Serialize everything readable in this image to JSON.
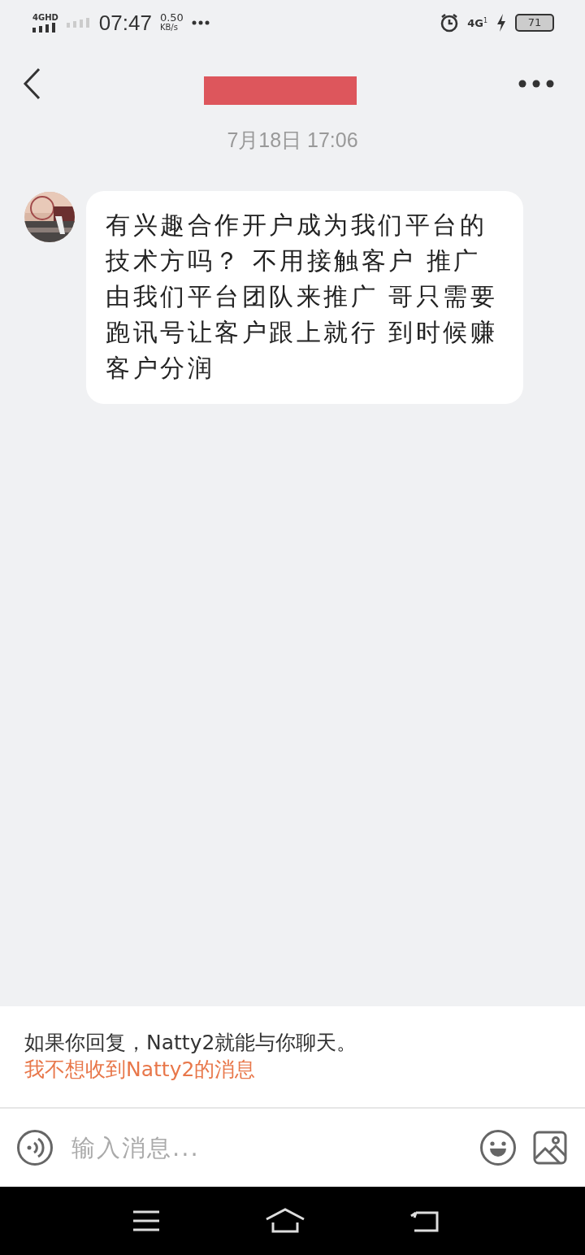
{
  "status_bar": {
    "network": "4GHD",
    "time": "07:47",
    "speed": "0.50",
    "speed_unit": "KB/s",
    "network_right": "4G",
    "sim": "1",
    "battery": "71"
  },
  "header": {
    "title_redacted": true
  },
  "date": "7月18日 17:06",
  "messages": [
    {
      "kind": "incoming",
      "text": "有兴趣合作开户成为我们平台的技术方吗？ 不用接触客户 推广由我们平台团队来推广 哥只需要跑讯号让客户跟上就行 到时候赚客户分润"
    }
  ],
  "notice": {
    "text": "如果你回复，Natty2就能与你聊天。",
    "link": "我不想收到Natty2的消息"
  },
  "composer": {
    "placeholder": "输入消息..."
  }
}
